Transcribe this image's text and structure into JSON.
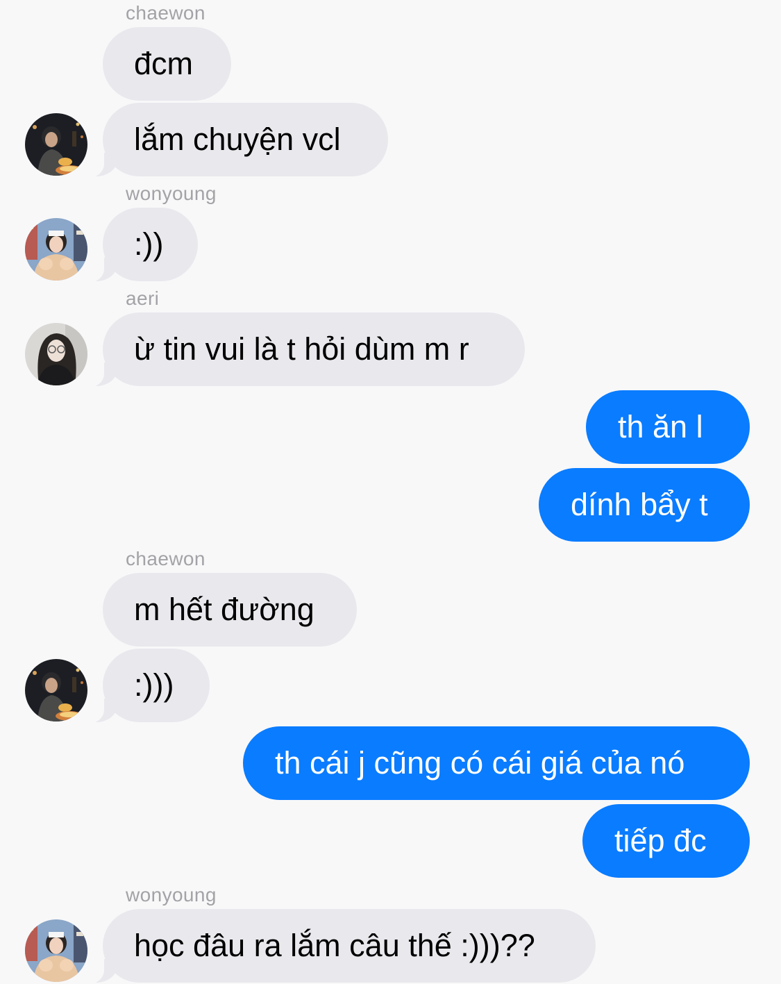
{
  "messages": [
    {
      "sender": "chaewon",
      "text": "đcm"
    },
    {
      "sender": "chaewon",
      "text": "lắm chuyện vcl"
    },
    {
      "sender": "wonyoung",
      "text": ":))"
    },
    {
      "sender": "aeri",
      "text": "ừ tin vui là t hỏi dùm m r"
    },
    {
      "sender": "me",
      "text": "th ăn l"
    },
    {
      "sender": "me",
      "text": "dính bẩy t"
    },
    {
      "sender": "chaewon",
      "text": "m hết đường"
    },
    {
      "sender": "chaewon",
      "text": ":)))"
    },
    {
      "sender": "me",
      "text": "th cái j cũng có cái giá của nó"
    },
    {
      "sender": "me",
      "text": "tiếp đc"
    },
    {
      "sender": "wonyoung",
      "text": "học đâu ra lắm câu thế :)))??"
    }
  ],
  "sender_labels": [
    "chaewon",
    "wonyoung",
    "aeri",
    "chaewon",
    "wonyoung"
  ],
  "colors": {
    "background": "#f8f8f9",
    "incoming_bubble": "#e9e8ed",
    "outgoing_bubble": "#0a7cff",
    "sender_name": "#a3a3a7"
  },
  "avatars": {
    "chaewon": "avatar-photo-icon",
    "wonyoung": "avatar-photo-icon",
    "aeri": "avatar-photo-icon"
  }
}
